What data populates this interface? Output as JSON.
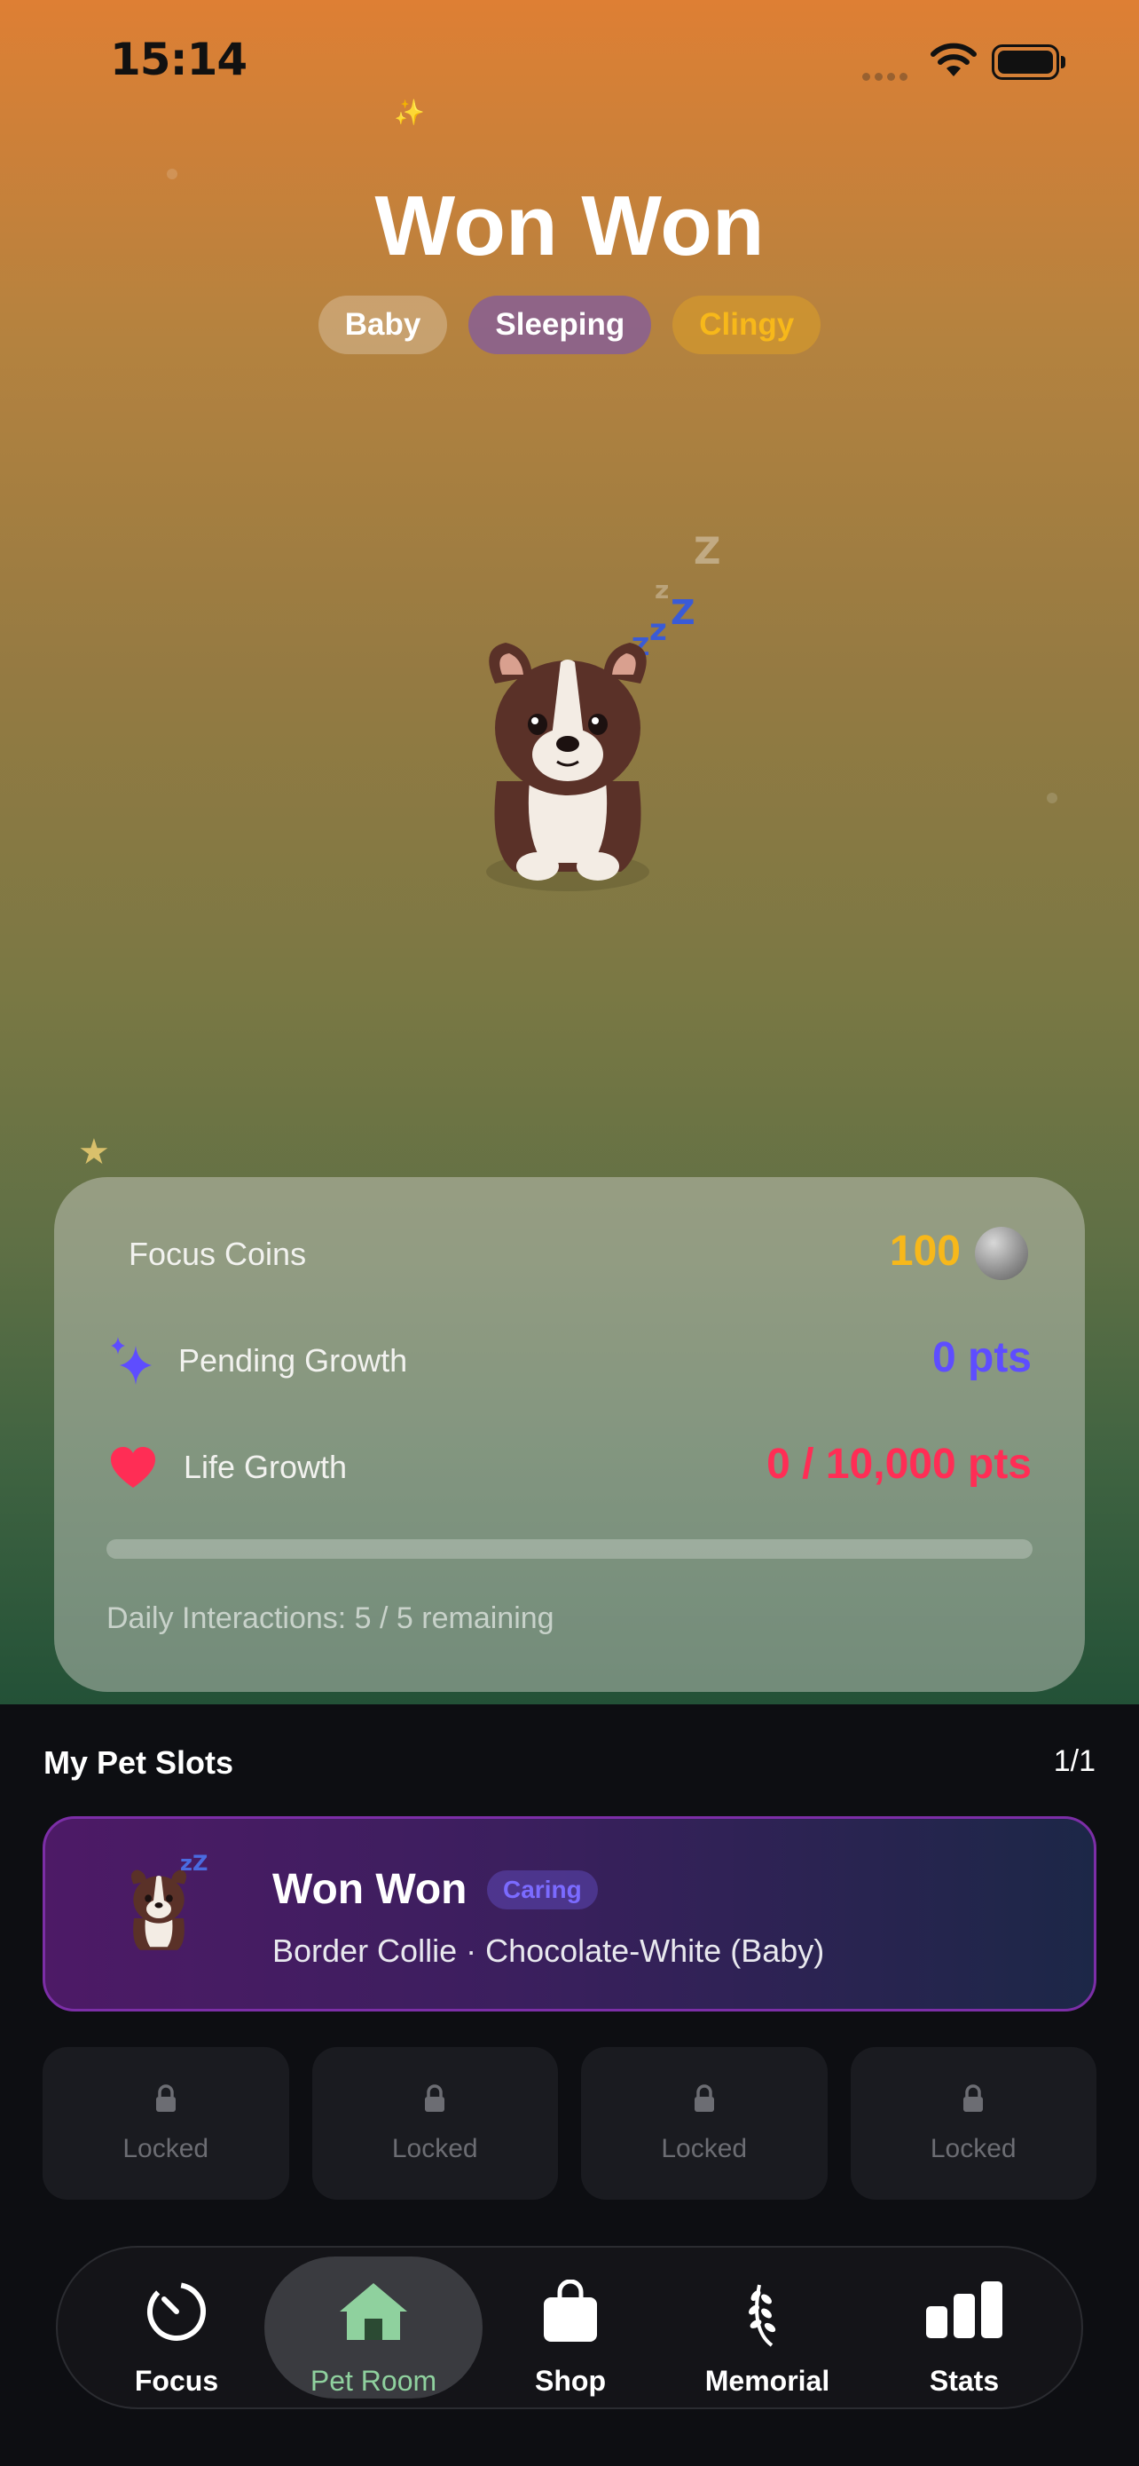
{
  "status_bar": {
    "time": "15:14"
  },
  "pet": {
    "name": "Won Won",
    "tags": [
      "Baby",
      "Sleeping",
      "Clingy"
    ],
    "sleep_letters": [
      "Z",
      "z",
      "Z",
      "z",
      "Z"
    ]
  },
  "stats_card": {
    "focus_coins_label": "Focus Coins",
    "focus_coins_value": "100",
    "pending_growth_label": "Pending Growth",
    "pending_growth_value": "0 pts",
    "life_growth_label": "Life Growth",
    "life_growth_value": "0 / 10,000 pts",
    "life_growth_progress": 0,
    "daily_interactions": "Daily Interactions: 5 / 5 remaining"
  },
  "slots": {
    "title": "My Pet Slots",
    "count": "1/1",
    "active": {
      "name": "Won Won",
      "badge": "Caring",
      "breed": "Border Collie · Chocolate-White (Baby)",
      "sleep_mark": "zZ"
    },
    "locked_label": "Locked"
  },
  "tabbar": {
    "items": [
      {
        "label": "Focus",
        "icon": "timer-icon"
      },
      {
        "label": "Pet Room",
        "icon": "house-icon",
        "active": true
      },
      {
        "label": "Shop",
        "icon": "shopping-bag-icon"
      },
      {
        "label": "Memorial",
        "icon": "laurel-icon"
      },
      {
        "label": "Stats",
        "icon": "bar-chart-icon"
      }
    ]
  },
  "colors": {
    "coins": "#f7b81a",
    "pending": "#5e4dff",
    "life": "#ff2d55",
    "tab_active": "#8fd19e"
  }
}
